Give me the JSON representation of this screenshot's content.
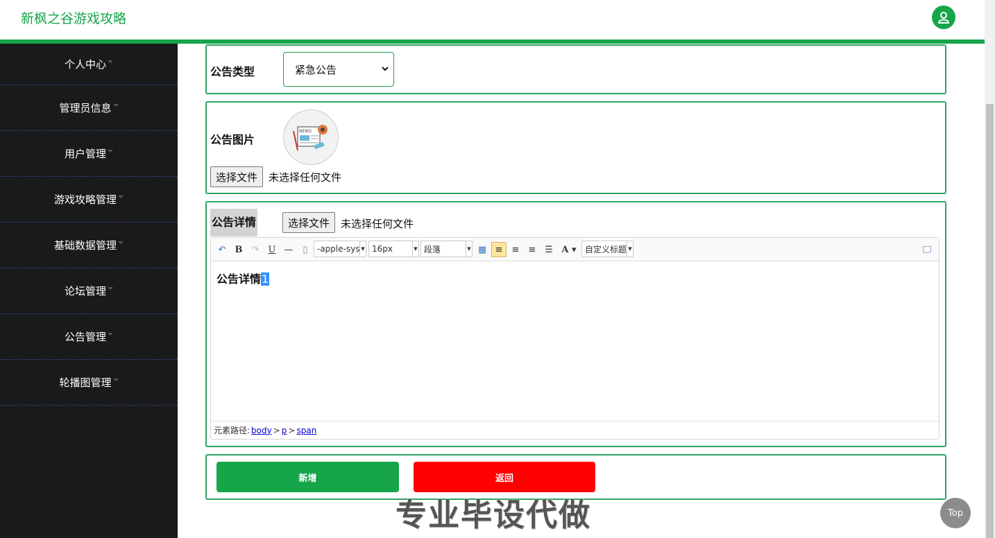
{
  "header": {
    "brand": "新枫之谷游戏攻略",
    "avatar_icon": "user-icon",
    "accent_color": "#17a54a"
  },
  "sidebar": {
    "items": [
      {
        "label": "个人中心"
      },
      {
        "label": "管理员信息"
      },
      {
        "label": "用户管理"
      },
      {
        "label": "游戏攻略管理"
      },
      {
        "label": "基础数据管理"
      },
      {
        "label": "论坛管理"
      },
      {
        "label": "公告管理"
      },
      {
        "label": "轮播图管理"
      }
    ]
  },
  "form": {
    "type_label": "公告类型",
    "type_value": "紧急公告",
    "image_label": "公告图片",
    "image_file_button": "选择文件",
    "image_file_status": "未选择任何文件",
    "detail_label": "公告详情",
    "detail_file_button": "选择文件",
    "detail_file_status": "未选择任何文件"
  },
  "editor": {
    "font_family": "-apple-sys",
    "font_size": "16px",
    "paragraph": "段落",
    "custom_heading": "自定义标题",
    "content": "公告详情",
    "selected_char": "1",
    "path_label": "元素路径:",
    "path": [
      "body",
      "p",
      "span"
    ]
  },
  "actions": {
    "add_label": "新增",
    "back_label": "返回",
    "add_color": "#17a54a",
    "back_color": "#ff0000"
  },
  "watermark": "专业毕设代做",
  "top_button": "Top"
}
